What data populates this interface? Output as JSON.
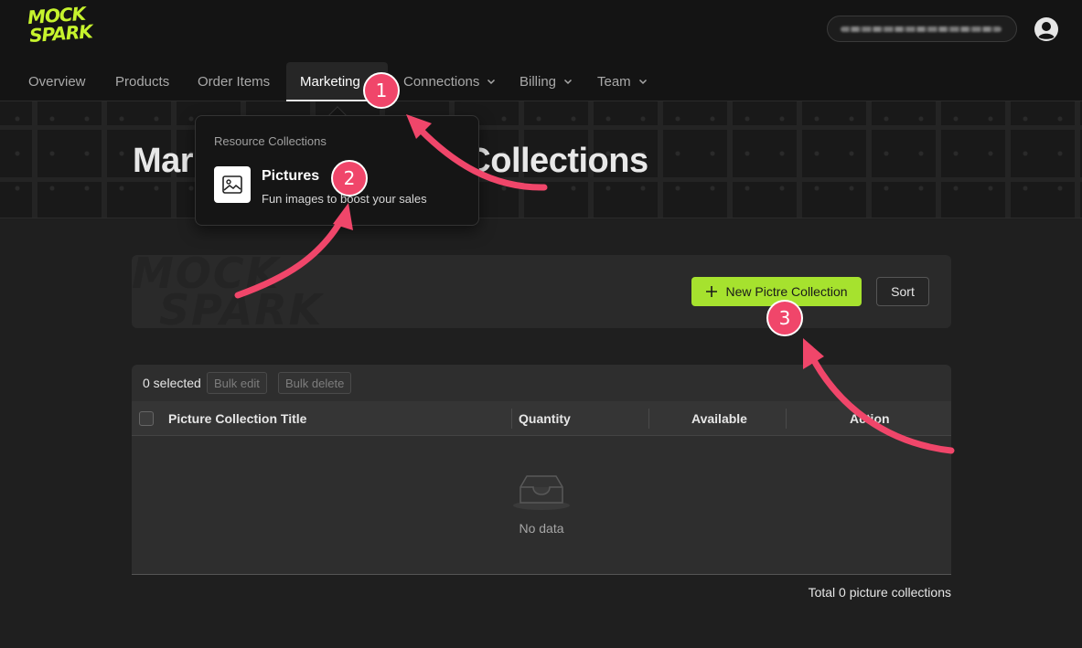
{
  "app": {
    "logo_line1": "MOCK",
    "logo_line2": "SPARK",
    "brand_color": "#c6f32d",
    "account_label": "user@example.com"
  },
  "nav": {
    "items": [
      {
        "label": "Overview",
        "active": false,
        "dropdown": false
      },
      {
        "label": "Products",
        "active": false,
        "dropdown": false
      },
      {
        "label": "Order Items",
        "active": false,
        "dropdown": false
      },
      {
        "label": "Marketing",
        "active": true,
        "dropdown": false
      },
      {
        "label": "Connections",
        "active": false,
        "dropdown": true
      },
      {
        "label": "Billing",
        "active": false,
        "dropdown": true
      },
      {
        "label": "Team",
        "active": false,
        "dropdown": true
      }
    ]
  },
  "hero": {
    "title": "Marketing Resource Collections"
  },
  "dropdown": {
    "group_label": "Resource Collections",
    "item_title": "Pictures",
    "item_description": "Fun images to boost your sales",
    "item_icon": "image-icon"
  },
  "toolbar": {
    "new_button_label": "New Pictre Collection",
    "new_button_icon": "plus-icon",
    "sort_button_label": "Sort",
    "primary_color": "#a6e22e"
  },
  "table": {
    "selected_text": "0 selected",
    "bulk_edit_label": "Bulk edit",
    "bulk_delete_label": "Bulk delete",
    "columns": [
      "Picture Collection Title",
      "Quantity",
      "Available",
      "Action"
    ],
    "empty_text": "No data",
    "total_text": "Total 0 picture collections"
  },
  "annotations": {
    "color": "#f0466a",
    "badges": [
      "1",
      "2",
      "3"
    ]
  }
}
